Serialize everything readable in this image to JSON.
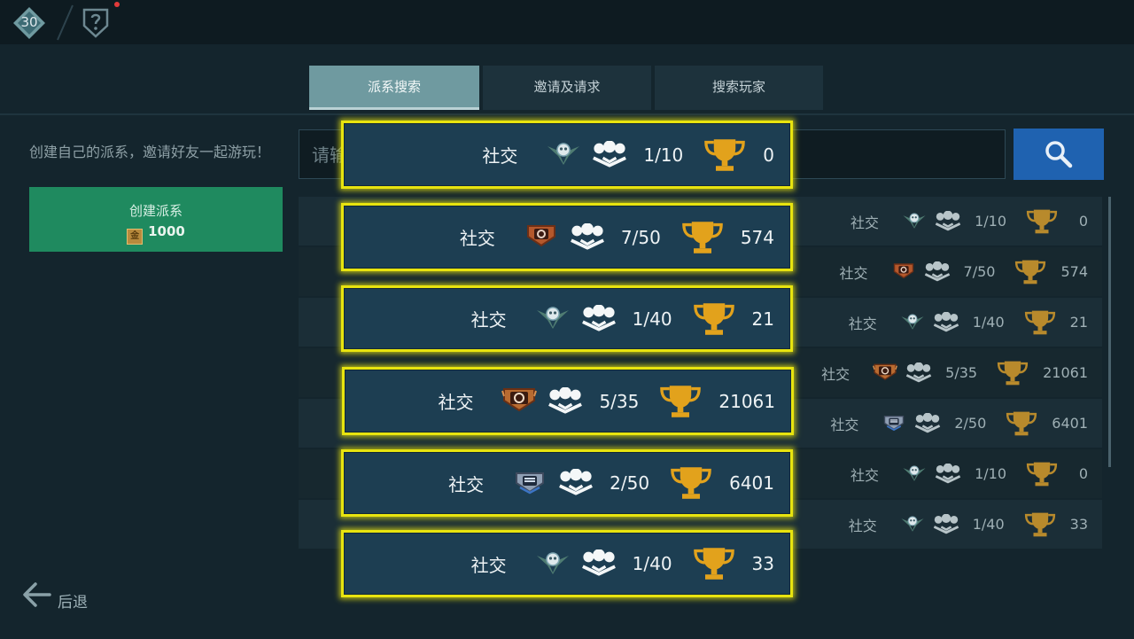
{
  "topbar": {
    "level": "30"
  },
  "tabs": [
    {
      "label": "派系搜索",
      "active": true
    },
    {
      "label": "邀请及请求",
      "active": false
    },
    {
      "label": "搜索玩家",
      "active": false
    }
  ],
  "sidebar": {
    "description": "创建自己的派系，邀请好友一起游玩！",
    "create_button": {
      "label": "创建派系",
      "cost": "1000",
      "coin_glyph": "金"
    }
  },
  "search": {
    "placeholder": "请输"
  },
  "list_rows": [
    {
      "name": "社交",
      "members": "1/10",
      "trophies": "0",
      "emblem": "gray-wings"
    },
    {
      "name": "社交",
      "members": "7/50",
      "trophies": "574",
      "emblem": "bronze-shield"
    },
    {
      "name": "社交",
      "members": "1/40",
      "trophies": "21",
      "emblem": "gray-wings"
    },
    {
      "name": "社交",
      "members": "5/35",
      "trophies": "21061",
      "emblem": "bronze-shield-large"
    },
    {
      "name": "社交",
      "members": "2/50",
      "trophies": "6401",
      "emblem": "silver-shield"
    },
    {
      "name": "社交",
      "members": "1/10",
      "trophies": "0",
      "emblem": "gray-wings"
    },
    {
      "name": "社交",
      "members": "1/40",
      "trophies": "33",
      "emblem": "gray-wings"
    }
  ],
  "highlight_cards": [
    {
      "name": "社交",
      "members": "1/10",
      "trophies": "0",
      "emblem": "gray-wings"
    },
    {
      "name": "社交",
      "members": "7/50",
      "trophies": "574",
      "emblem": "bronze-shield"
    },
    {
      "name": "社交",
      "members": "1/40",
      "trophies": "21",
      "emblem": "gray-wings"
    },
    {
      "name": "社交",
      "members": "5/35",
      "trophies": "21061",
      "emblem": "bronze-shield-large"
    },
    {
      "name": "社交",
      "members": "2/50",
      "trophies": "6401",
      "emblem": "silver-shield"
    },
    {
      "name": "社交",
      "members": "1/40",
      "trophies": "33",
      "emblem": "gray-wings"
    }
  ],
  "footer": {
    "back_label": "后退"
  },
  "colors": {
    "accent_green": "#1f8a5f",
    "search_blue": "#1f62b0",
    "highlight_yellow": "#e8e40f",
    "trophy_gold": "#e2a21c"
  }
}
